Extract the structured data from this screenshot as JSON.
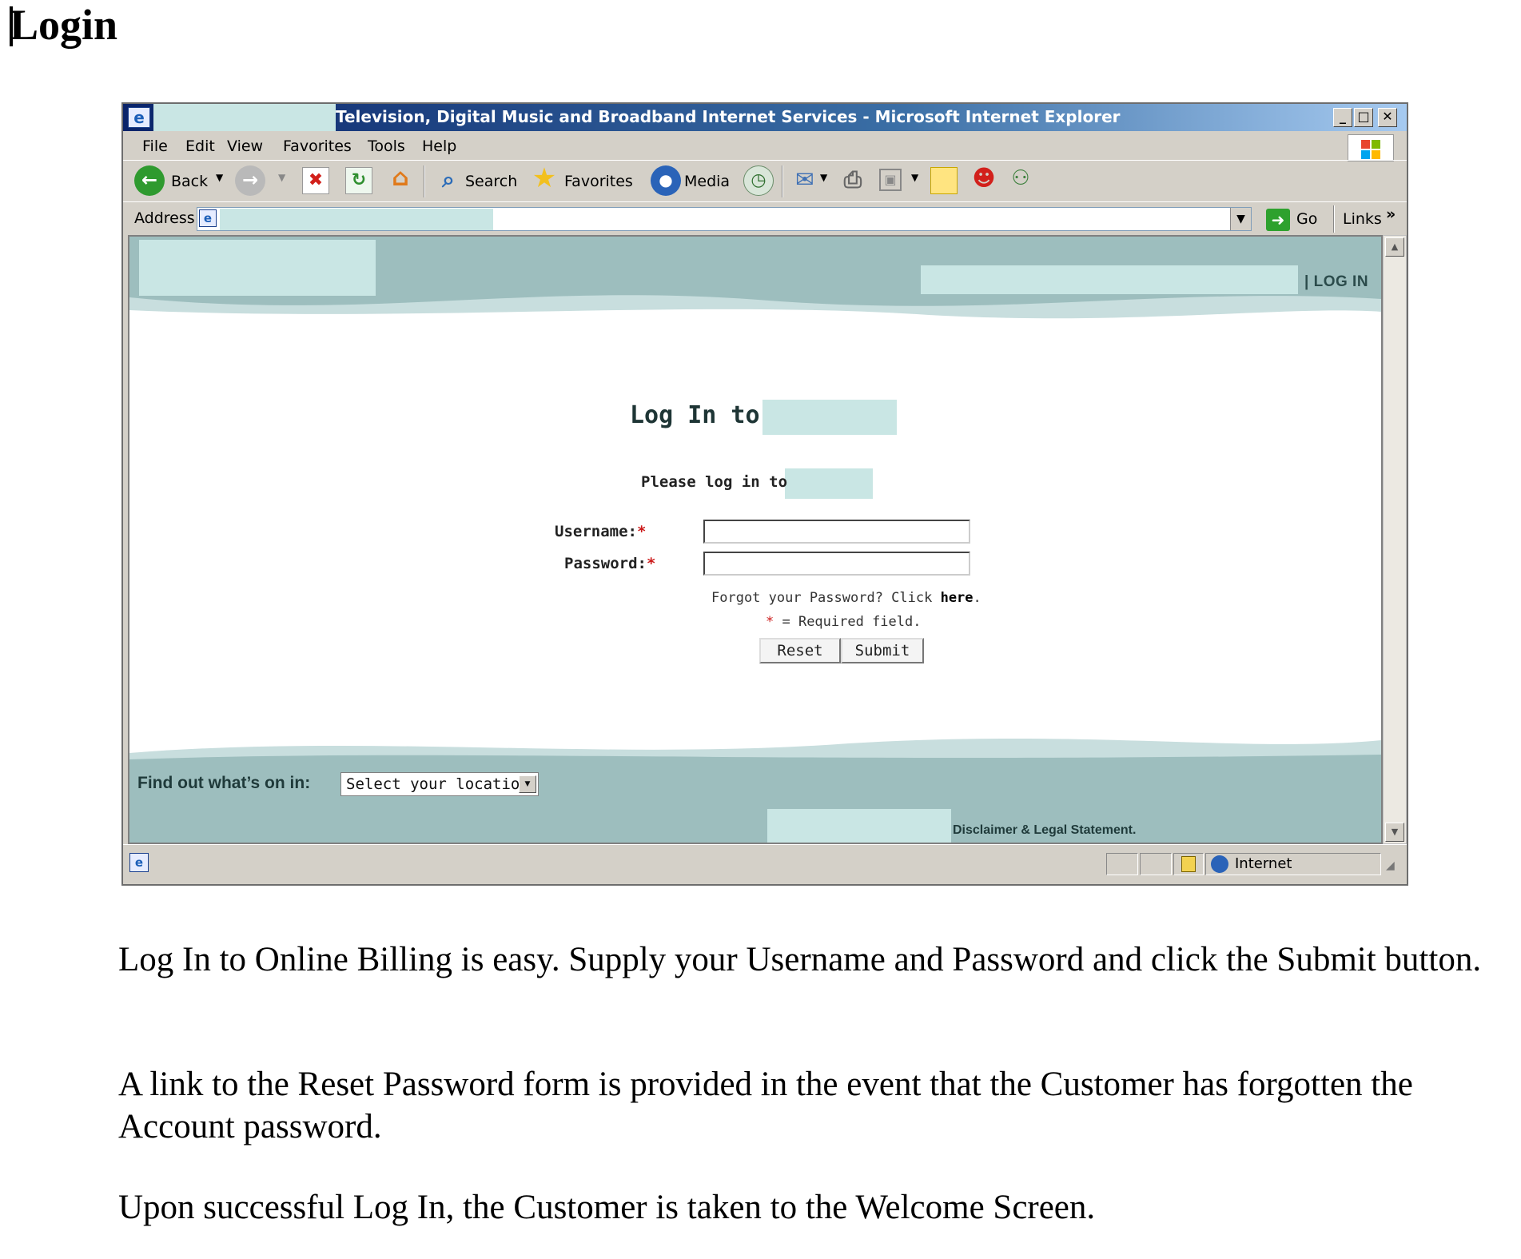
{
  "document": {
    "heading": "Login",
    "paragraphs": [
      "Log In to Online Billing is easy. Supply your Username and Password and click the Submit button.",
      "A link to the Reset Password form is provided in the event that the Customer has forgotten the Account password.",
      "Upon successful Log In, the Customer is taken to the Welcome Screen."
    ]
  },
  "browser": {
    "title": "Television, Digital Music and Broadband Internet Services - Microsoft Internet Explorer",
    "menu": [
      "File",
      "Edit",
      "View",
      "Favorites",
      "Tools",
      "Help"
    ],
    "toolbar": {
      "back": "Back",
      "search": "Search",
      "favorites": "Favorites",
      "media": "Media"
    },
    "address_label": "Address",
    "go_label": "Go",
    "links_label": "Links",
    "links_chevron": "»",
    "status_zone": "Internet"
  },
  "page": {
    "nav_login": "|  LOG IN",
    "form_title": "Log In to",
    "please_text": "Please log in to",
    "username_label": "Username:",
    "password_label": "Password:",
    "required_mark": "*",
    "forgot_text": "Forgot your Password? Click ",
    "forgot_link": "here",
    "forgot_end": ".",
    "required_note": " = Required field.",
    "reset_button": "Reset",
    "submit_button": "Submit",
    "find_label": "Find out what’s on in:",
    "location_select": "Select your location",
    "disclaimer": "Disclaimer & Legal Statement."
  },
  "colors": {
    "band": "#9dbebe",
    "redacted": "#c9e6e4",
    "required": "#cc1b1b"
  }
}
